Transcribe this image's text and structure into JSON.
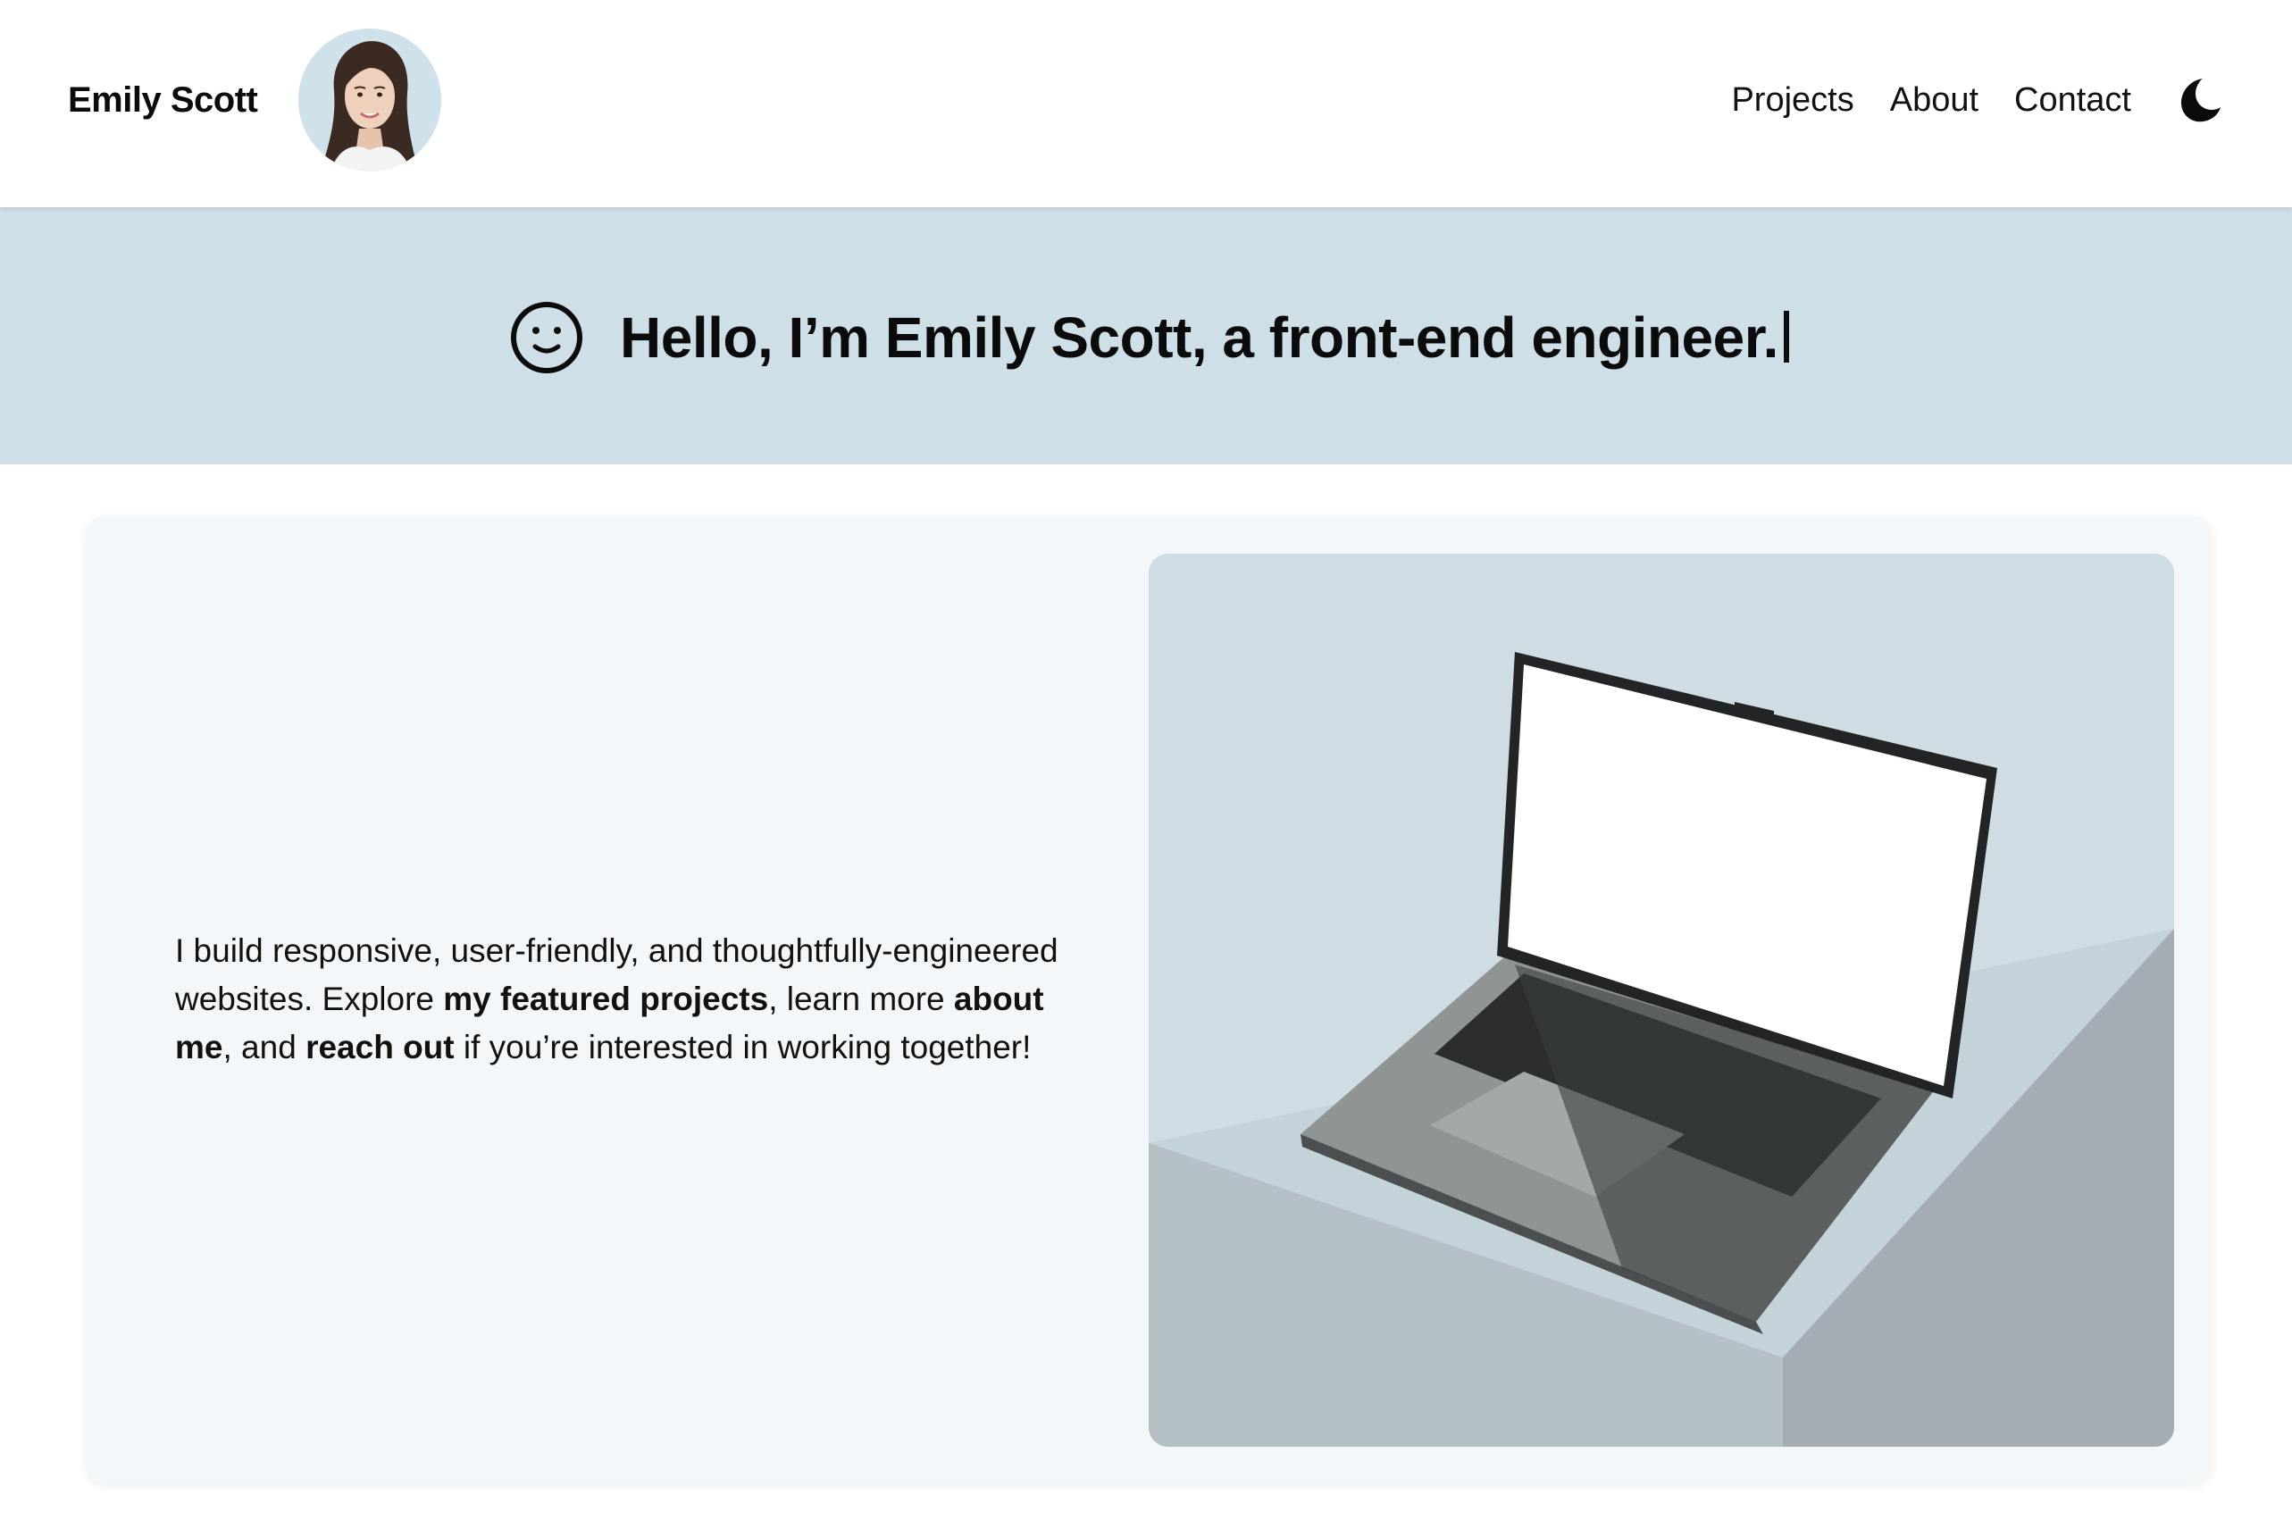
{
  "header": {
    "brand": "Emily Scott",
    "nav": [
      {
        "label": "Projects"
      },
      {
        "label": "About"
      },
      {
        "label": "Contact"
      }
    ],
    "theme_toggle_icon": "moon-icon"
  },
  "hero": {
    "icon": "smiley-icon",
    "title": "Hello, I’m Emily Scott, a front-end engineer."
  },
  "intro": {
    "part1": "I build responsive, user-friendly, and thoughtfully-engineered websites. Explore ",
    "link_projects": "my featured projects",
    "part2": ", learn more ",
    "link_about": "about me",
    "part3": ", and ",
    "link_contact": "reach out",
    "part4": " if you’re interested in working together!"
  },
  "colors": {
    "hero_bg": "#cedfe8",
    "card_bg": "#f4f7f9",
    "text": "#0b0b0b"
  }
}
